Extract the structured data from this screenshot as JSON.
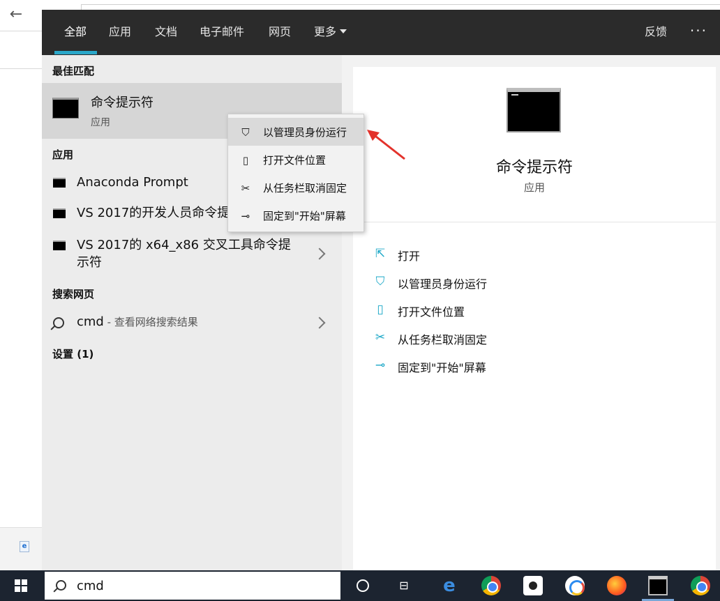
{
  "top_tabs": {
    "all": "全部",
    "apps": "应用",
    "docs": "文档",
    "email": "电子邮件",
    "web": "网页",
    "more": "更多",
    "feedback": "反馈",
    "overflow": "···"
  },
  "left": {
    "best_match_heading": "最佳匹配",
    "best_match": {
      "title": "命令提示符",
      "subtitle": "应用"
    },
    "apps_heading": "应用",
    "apps": [
      {
        "label": "Anaconda Prompt"
      },
      {
        "label": "VS 2017的开发人员命令提"
      },
      {
        "label_line1": "VS 2017的 x64_x86 交叉工具命令提",
        "label_line2": "示符"
      }
    ],
    "web_heading": "搜索网页",
    "web_query": "cmd",
    "web_suffix": " - 查看网络搜索结果",
    "settings_heading": "设置 (1)"
  },
  "context_menu": [
    {
      "label": "以管理员身份运行",
      "icon": "shield-icon"
    },
    {
      "label": "打开文件位置",
      "icon": "folder-location-icon"
    },
    {
      "label": "从任务栏取消固定",
      "icon": "unpin-icon"
    },
    {
      "label": "固定到\"开始\"屏幕",
      "icon": "pin-icon"
    }
  ],
  "preview": {
    "title": "命令提示符",
    "subtitle": "应用",
    "actions": [
      {
        "label": "打开",
        "icon": "open-icon"
      },
      {
        "label": "以管理员身份运行",
        "icon": "shield-icon"
      },
      {
        "label": "打开文件位置",
        "icon": "folder-location-icon"
      },
      {
        "label": "从任务栏取消固定",
        "icon": "unpin-icon"
      },
      {
        "label": "固定到\"开始\"屏幕",
        "icon": "pin-icon"
      }
    ]
  },
  "taskbar": {
    "search_value": "cmd",
    "bg_ie_glyph": "e"
  },
  "colors": {
    "accent": "#2aa7c9",
    "topbar": "#2b2b2b",
    "taskbar": "#1c2430",
    "arrow": "#e3322b"
  }
}
